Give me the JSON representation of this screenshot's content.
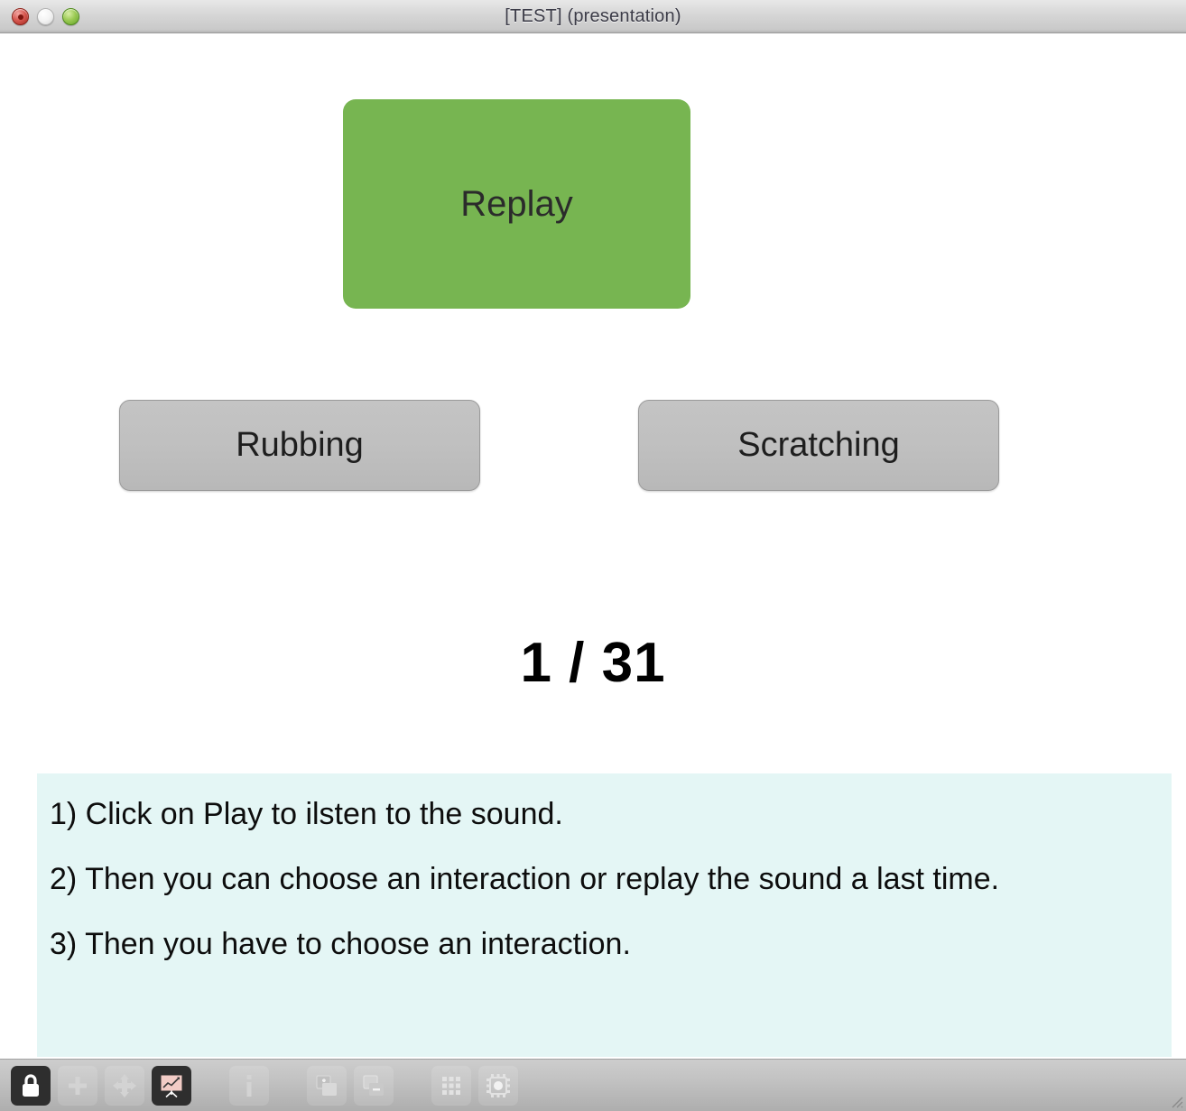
{
  "window": {
    "title": "[TEST] (presentation)",
    "controls": [
      {
        "name": "close",
        "label": "Close"
      },
      {
        "name": "minimize",
        "label": "Minimize"
      },
      {
        "name": "zoom",
        "label": "Zoom"
      }
    ]
  },
  "main": {
    "replay_button": {
      "label": "Replay",
      "color": "#77b551"
    },
    "choices": [
      {
        "label": "Rubbing"
      },
      {
        "label": "Scratching"
      }
    ],
    "counter": "1 / 31",
    "instructions": {
      "background": "#e4f6f5",
      "lines": [
        "1) Click on Play to ilsten to the sound.",
        "2) Then you can choose an interaction or replay the sound a last time.",
        "3) Then you have to choose an interaction."
      ]
    }
  },
  "toolbar": {
    "items": [
      {
        "icon": "lock-icon",
        "label": "Lock",
        "active": true
      },
      {
        "icon": "plus-icon",
        "label": "Add",
        "active": false
      },
      {
        "icon": "move-icon",
        "label": "Move",
        "active": false
      },
      {
        "icon": "presentation-icon",
        "label": "Presentation",
        "active": false
      },
      {
        "icon": "info-icon",
        "label": "Info",
        "active": false
      },
      {
        "icon": "add-slide-icon",
        "label": "Add Slide",
        "active": false
      },
      {
        "icon": "remove-slide-icon",
        "label": "Remove Slide",
        "active": false
      },
      {
        "icon": "grid-icon",
        "label": "Grid",
        "active": false
      },
      {
        "icon": "settings-icon",
        "label": "Settings",
        "active": false
      }
    ]
  }
}
